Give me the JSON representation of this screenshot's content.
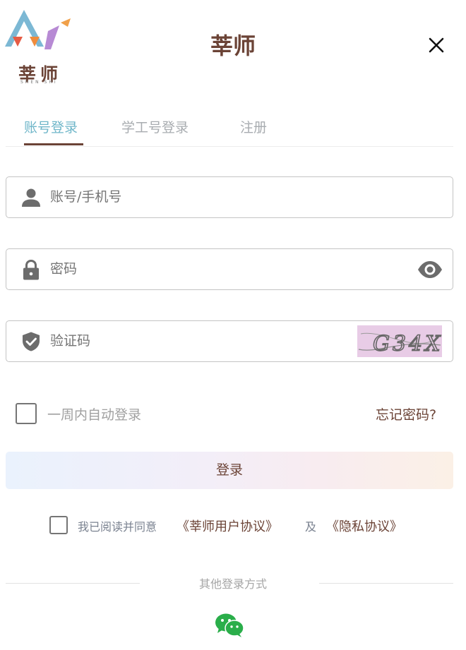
{
  "header": {
    "logo_text": "莘师",
    "logo_sub": "SHEN SHI",
    "title": "莘师"
  },
  "tabs": [
    {
      "label": "账号登录",
      "active": true
    },
    {
      "label": "学工号登录",
      "active": false
    },
    {
      "label": "注册",
      "active": false
    }
  ],
  "form": {
    "account": {
      "placeholder": "账号/手机号",
      "value": "",
      "icon": "person-icon"
    },
    "password": {
      "placeholder": "密码",
      "value": "",
      "icon": "lock-icon",
      "toggle_icon": "eye-icon"
    },
    "captcha": {
      "placeholder": "验证码",
      "value": "",
      "icon": "shield-check-icon",
      "image_text": "G34X"
    }
  },
  "remember": {
    "label": "一周内自动登录",
    "checked": false
  },
  "forgot_label": "忘记密码?",
  "login_label": "登录",
  "agreement": {
    "checked": false,
    "prefix": "我已阅读并同意",
    "user_agreement": "《莘师用户协议》",
    "conjunction": "及",
    "privacy": "《隐私协议》"
  },
  "other_login": {
    "label": "其他登录方式",
    "icon": "wechat-icon"
  },
  "colors": {
    "brand": "#6b4336",
    "active_tab": "#6fb6c9",
    "muted": "#a8acb0",
    "wechat": "#2aae4a"
  }
}
